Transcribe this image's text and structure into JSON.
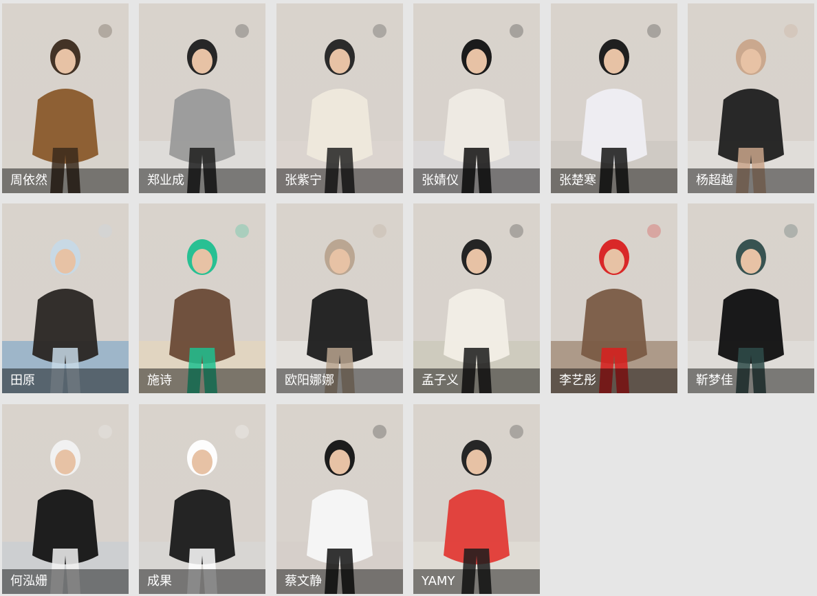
{
  "page": {
    "background": "#e6e6e6"
  },
  "gallery": {
    "items": [
      {
        "name": "周依然",
        "bg": "#d9d3cc",
        "fg": "#8a5a2b",
        "accent": "#3b2a1c"
      },
      {
        "name": "郑业成",
        "bg": "#e4e4e4",
        "fg": "#9a9a9a",
        "accent": "#1d1d1d"
      },
      {
        "name": "张紫宁",
        "bg": "#ded6d2",
        "fg": "#efe9dc",
        "accent": "#222222"
      },
      {
        "name": "张婧仪",
        "bg": "#dcdde2",
        "fg": "#efebe4",
        "accent": "#111111"
      },
      {
        "name": "张楚寒",
        "bg": "#c9c3be",
        "fg": "#efeef3",
        "accent": "#151515"
      },
      {
        "name": "杨超越",
        "bg": "#e7e6e3",
        "fg": "#1f1f1f",
        "accent": "#c9a58a"
      },
      {
        "name": "田原",
        "bg": "#6f9fc6",
        "fg": "#2a2623",
        "accent": "#c7d9e6"
      },
      {
        "name": "施诗",
        "bg": "#ead7b8",
        "fg": "#6a4a36",
        "accent": "#1fbf8f"
      },
      {
        "name": "欧阳娜娜",
        "bg": "#eeeceb",
        "fg": "#1c1c1c",
        "accent": "#b8a38e"
      },
      {
        "name": "孟子义",
        "bg": "#c7c5b3",
        "fg": "#f2eee6",
        "accent": "#1a1a1a"
      },
      {
        "name": "李艺彤",
        "bg": "#8a6b52",
        "fg": "#7a5b45",
        "accent": "#d91f1f"
      },
      {
        "name": "靳梦佳",
        "bg": "#e6e3e2",
        "fg": "#0f0f10",
        "accent": "#2f4c4a"
      },
      {
        "name": "何泓姗",
        "bg": "#c5ccd6",
        "fg": "#141414",
        "accent": "#f2f2f2"
      },
      {
        "name": "成果",
        "bg": "#d8d8d8",
        "fg": "#1a1a1a",
        "accent": "#ffffff"
      },
      {
        "name": "蔡文静",
        "bg": "#d6ccc9",
        "fg": "#f7f7f7",
        "accent": "#121212"
      },
      {
        "name": "YAMY",
        "bg": "#e6e1da",
        "fg": "#e23b36",
        "accent": "#1c1c1c"
      }
    ]
  }
}
